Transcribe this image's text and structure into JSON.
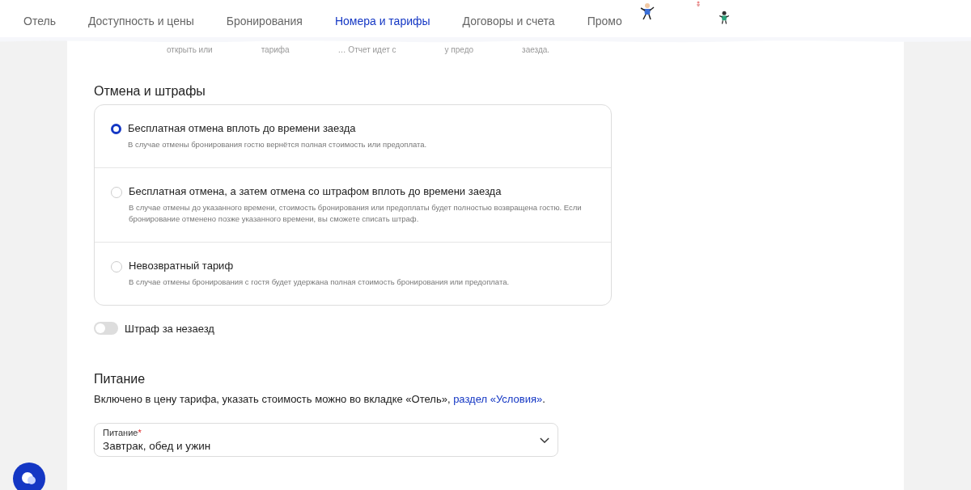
{
  "nav": [
    {
      "label": "Отель",
      "selected": false
    },
    {
      "label": "Доступность и цены",
      "selected": false
    },
    {
      "label": "Бронирования",
      "selected": false
    },
    {
      "label": "Номера и тарифы",
      "selected": true
    },
    {
      "label": "Договоры и счета",
      "selected": false
    },
    {
      "label": "Промо",
      "selected": false
    }
  ],
  "faded_line": [
    "открыть или",
    "тарифа",
    "… Отчет идет с",
    "у предо",
    "заезда."
  ],
  "cancellation": {
    "title": "Отмена и штрафы",
    "options": [
      {
        "label": "Бесплатная отмена вплоть до времени заезда",
        "description": "В случае отмены бронирования гостю вернётся полная стоимость или предоплата.",
        "selected": true
      },
      {
        "label": "Бесплатная отмена, а затем отмена со штрафом вплоть до времени заезда",
        "description": "В случае отмены до указанного времени, стоимость бронирования или предоплаты будет полностью возвращена гостю. Если бронирование отменено позже указанного времени, вы сможете списать штраф.",
        "selected": false
      },
      {
        "label": "Невозвратный тариф",
        "description": "В случае отмены бронирования с гостя будет удержана полная стоимость бронирования или предоплата.",
        "selected": false
      }
    ],
    "no_show_toggle": {
      "label": "Штраф за незаезд",
      "on": false
    }
  },
  "meals": {
    "title": "Питание",
    "note": "Включено в цену тарифа, указать стоимость можно во вкладке «Отель», ",
    "link": "раздел «Условия»",
    "after_link": ".",
    "select": {
      "label": "Питание",
      "required_mark": "*",
      "value": "Завтрак, обед и ужин"
    }
  }
}
